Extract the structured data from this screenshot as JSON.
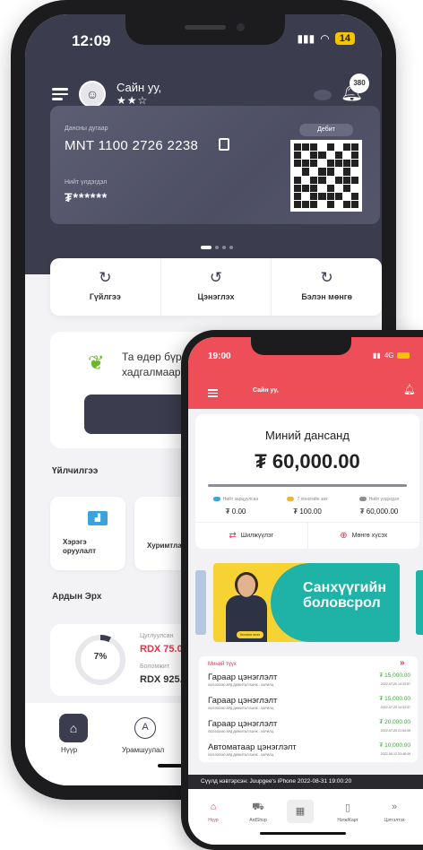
{
  "phone1": {
    "status": {
      "time": "12:09",
      "battery": "14"
    },
    "header": {
      "greeting": "Сайн уу,",
      "stars": "★★☆",
      "notification_count": "380"
    },
    "card": {
      "account_label": "Дансны дугаар",
      "account_number": "MNT 1100 2726 2238",
      "balance_label": "Нийт үлдэгдэл",
      "balance_masked": "₮******",
      "type_label": "Дебит"
    },
    "actions": [
      {
        "label": "Гүйлгээ",
        "icon": "transfer-icon"
      },
      {
        "label": "Цэнэглэх",
        "icon": "topup-icon"
      },
      {
        "label": "Бэлэн мөнгө",
        "icon": "atm-icon"
      }
    ],
    "promo": {
      "line1": "Та өдөр бүрийн гүй",
      "line2": "хадгалмаар бай"
    },
    "services": {
      "title": "Үйлчилгээ",
      "items": [
        {
          "label_1": "Хэрэгэ",
          "label_2": "оруулалт"
        },
        {
          "label_1": "Хуримтлал",
          "label_2": ""
        }
      ]
    },
    "bonus": {
      "title": "Ардын Эрх",
      "percent": "7%",
      "collected_label": "Цуглуулсан",
      "collected_value": "RDX 75.00",
      "target_label": "Боломжит",
      "target_value": "RDX 925.00"
    },
    "nav": [
      {
        "label": "Нүүр"
      },
      {
        "label": "Урамшуулал"
      }
    ]
  },
  "phone2": {
    "status": {
      "time": "19:00",
      "network": "4G"
    },
    "header": {
      "title": "Сайн уу,"
    },
    "account": {
      "title": "Миний дансанд",
      "amount": "₮ 60,000.00",
      "legend": [
        {
          "key": "Нийт зарцуулсан",
          "value": "₮ 0.00",
          "color": "#3aa3dc"
        },
        {
          "key": "7 хоногийн зах",
          "value": "₮ 100.00",
          "color": "#f0b23a"
        },
        {
          "key": "Нийт үлдэгдэл",
          "value": "₮ 60,000.00",
          "color": "#8c8c95"
        }
      ],
      "buttons": [
        {
          "label": "Шилжүүлэг"
        },
        {
          "label": "Мөнгө хүсэх"
        }
      ]
    },
    "banner": {
      "line1": "Санхүүгийн",
      "line2": "боловсрол",
      "tag": "Хичээл эхэл"
    },
    "transactions": {
      "title": "Миний түүх",
      "more": "»",
      "rows": [
        {
          "name": "Гараар цэнэглэлт",
          "sub": "0021002040 АРД ДИЖИТАЛ БАНК - ХАРИЛЦ",
          "amount": "₮ 15,000.00",
          "date": "2022-07-20 14:33:57"
        },
        {
          "name": "Гараар цэнэглэлт",
          "sub": "0021002040 АРД ДИЖИТАЛ БАНК - ХАРИЛЦ",
          "amount": "₮ 15,000.00",
          "date": "2022-07-20 14:33:37"
        },
        {
          "name": "Гараар цэнэглэлт",
          "sub": "0021002040 АРД ДИЖИТАЛ БАНК - ХАРИЛЦ",
          "amount": "₮ 20,000.00",
          "date": "2022-07-20 21:54:39"
        },
        {
          "name": "Автоматаар цэнэглэлт",
          "sub": "0021002040 АРД ДИЖИТАЛ БАНК - ХАРИЛЦ",
          "amount": "₮ 10,000.00",
          "date": "2022-05-12 23:48:49"
        }
      ]
    },
    "ticker": "Сүүлд нэвтэрсэн: Juupgee's iPhone 2022-08-31 19:00:20",
    "nav": [
      {
        "label": "Нүүр"
      },
      {
        "label": "АrdShop"
      },
      {
        "label": "Нэгж/Карт"
      },
      {
        "label": "Цэтгэлтэх"
      }
    ]
  }
}
